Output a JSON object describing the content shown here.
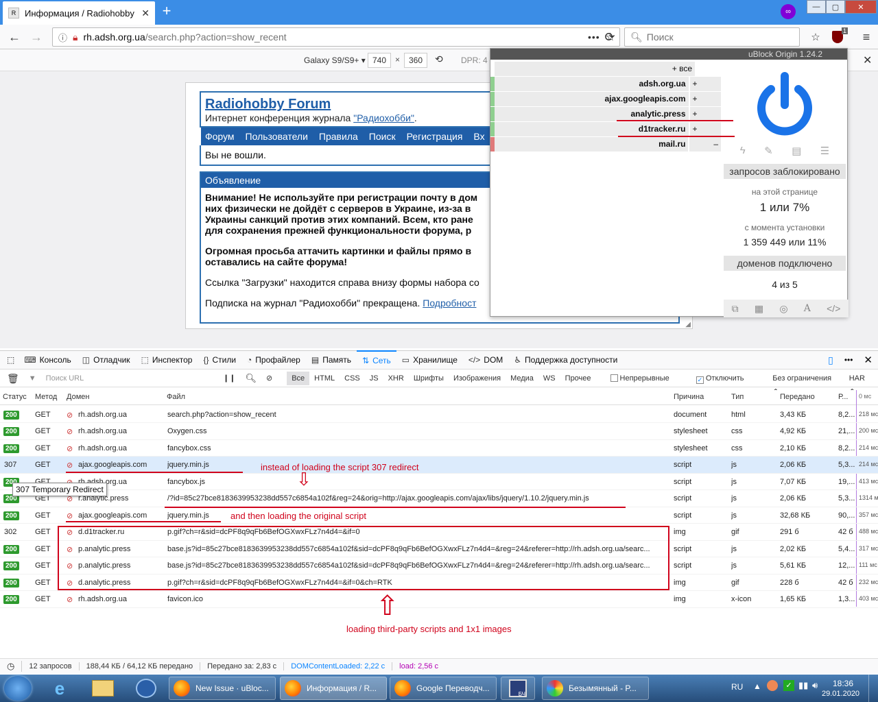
{
  "browser": {
    "tab_title": "Информация / Radiohobby Fo",
    "url_host": "rh.adsh.org.ua",
    "url_path": "/search.php?action=show_recent",
    "search_placeholder": "Поиск",
    "ext_badge": "1",
    "url_menu": "•••",
    "win_min": "—",
    "win_max": "▢",
    "win_close": "✕"
  },
  "responsive": {
    "device": "Galaxy S9/S9+ ▾",
    "width": "740",
    "height": "360",
    "dpr": "DPR: 4"
  },
  "forum": {
    "title": "Radiohobby Forum",
    "subtitle_pre": "Интернет конференция журнала ",
    "subtitle_link": "\"Радиохобби\"",
    "subtitle_post": ".",
    "menu": [
      "Форум",
      "Пользователи",
      "Правила",
      "Поиск",
      "Регистрация",
      "Вх"
    ],
    "not_logged": "Вы не вошли.",
    "announce_title": "Объявление",
    "p1": "Внимание! Не используйте при регистрации почту в дом них физически не дойдёт с серверов в Украине, из-за в Украины санкций против этих компаний. Всем, кто ране для сохранения прежней функциональности форума, р",
    "p2": "Огромная просьба аттачить картинки и файлы прямо в оставались на сайте форума!",
    "p3": "Ссылка \"Загрузки\" находится справа внизу формы набора со",
    "p4_pre": "Подписка на журнал \"Радиохобби\" прекращена. ",
    "p4_link": "Подробност"
  },
  "ublock": {
    "title": "uBlock Origin 1.24.2",
    "all": "+ все",
    "domains": [
      {
        "name": "adsh.org.ua",
        "mark": "+",
        "color": "#8fcf8f"
      },
      {
        "name": "ajax.googleapis.com",
        "mark": "+",
        "color": "#8fcf8f"
      },
      {
        "name": "analytic.press",
        "mark": "+",
        "color": "#8fcf8f"
      },
      {
        "name": "d1tracker.ru",
        "mark": "+",
        "color": "#8fcf8f"
      },
      {
        "name": "mail.ru",
        "mark": "–",
        "color": "#e07a7a"
      }
    ],
    "blocked_label": "запросов заблокировано",
    "on_page_label": "на этой странице",
    "on_page_value": "1 или 7%",
    "since_install_label": "с момента установки",
    "since_install_value": "1 359 449 или 11%",
    "domains_label": "доменов подключено",
    "domains_value": "4 из 5",
    "accent": "#1a73e8"
  },
  "devtools": {
    "tabs": [
      {
        "icon": "⌨",
        "label": "Консоль"
      },
      {
        "icon": "◫",
        "label": "Отладчик"
      },
      {
        "icon": "⬚",
        "label": "Инспектор"
      },
      {
        "icon": "{}",
        "label": "Стили"
      },
      {
        "icon": "◔",
        "label": "Профайлер"
      },
      {
        "icon": "▤",
        "label": "Память"
      },
      {
        "icon": "⇅",
        "label": "Сеть"
      },
      {
        "icon": "▭",
        "label": "Хранилище"
      },
      {
        "icon": "</>",
        "label": "DOM"
      },
      {
        "icon": "♿",
        "label": "Поддержка доступности"
      }
    ],
    "filter_placeholder": "Поиск URL",
    "filters": [
      "Все",
      "HTML",
      "CSS",
      "JS",
      "XHR",
      "Шрифты",
      "Изображения",
      "Медиа",
      "WS",
      "Прочее"
    ],
    "persist_logs": "Непрерывные логи",
    "disable_cache": "Отключить кэш",
    "throttle": "Без ограничения ⇕",
    "har": "HAR ⇕",
    "columns": {
      "status": "Статус",
      "method": "Метод",
      "domain": "Домен",
      "file": "Файл",
      "cause": "Причина",
      "type": "Тип",
      "transferred": "Передано",
      "size": "Р...",
      "timeline": "0 мс"
    },
    "rows": [
      {
        "status": "200",
        "method": "GET",
        "domain": "rh.adsh.org.ua",
        "file": "search.php?action=show_recent",
        "cause": "document",
        "type": "html",
        "transferred": "3,43 КБ",
        "size": "8,2...",
        "time": "218 мс"
      },
      {
        "status": "200",
        "method": "GET",
        "domain": "rh.adsh.org.ua",
        "file": "Oxygen.css",
        "cause": "stylesheet",
        "type": "css",
        "transferred": "4,92 КБ",
        "size": "21,...",
        "time": "200 мс"
      },
      {
        "status": "200",
        "method": "GET",
        "domain": "rh.adsh.org.ua",
        "file": "fancybox.css",
        "cause": "stylesheet",
        "type": "css",
        "transferred": "2,10 КБ",
        "size": "8,2...",
        "time": "214 мс"
      },
      {
        "status": "307",
        "method": "GET",
        "domain": "ajax.googleapis.com",
        "file": "jquery.min.js",
        "cause": "script",
        "type": "js",
        "transferred": "2,06 КБ",
        "size": "5,3...",
        "time": "214 мс"
      },
      {
        "status": "200",
        "method": "GET",
        "domain": "rh.adsh.org.ua",
        "file": "fancybox.js",
        "cause": "script",
        "type": "js",
        "transferred": "7,07 КБ",
        "size": "19,...",
        "time": "413 мс"
      },
      {
        "status": "200",
        "method": "GET",
        "domain": "r.analytic.press",
        "file": "/?id=85c27bce8183639953238dd557c6854a102f&reg=24&orig=http://ajax.googleapis.com/ajax/libs/jquery/1.10.2/jquery.min.js",
        "cause": "script",
        "type": "js",
        "transferred": "2,06 КБ",
        "size": "5,3...",
        "time": "1314 м"
      },
      {
        "status": "200",
        "method": "GET",
        "domain": "ajax.googleapis.com",
        "file": "jquery.min.js",
        "cause": "script",
        "type": "js",
        "transferred": "32,68 КБ",
        "size": "90,...",
        "time": "357 мс"
      },
      {
        "status": "302",
        "method": "GET",
        "domain": "d.d1tracker.ru",
        "file": "p.gif?ch=r&sid=dcPF8q9qFb6BefOGXwxFLz7n4d4=&if=0",
        "cause": "img",
        "type": "gif",
        "transferred": "291 б",
        "size": "42 б",
        "time": "488 мс"
      },
      {
        "status": "200",
        "method": "GET",
        "domain": "p.analytic.press",
        "file": "base.js?id=85c27bce8183639953238dd557c6854a102f&sid=dcPF8q9qFb6BefOGXwxFLz7n4d4=&reg=24&referer=http://rh.adsh.org.ua/searc...",
        "cause": "script",
        "type": "js",
        "transferred": "2,02 КБ",
        "size": "5,4...",
        "time": "317 мс"
      },
      {
        "status": "200",
        "method": "GET",
        "domain": "p.analytic.press",
        "file": "base.js?id=85c27bce8183639953238dd557c6854a102f&sid=dcPF8q9qFb6BefOGXwxFLz7n4d4=&reg=24&referer=http://rh.adsh.org.ua/searc...",
        "cause": "script",
        "type": "js",
        "transferred": "5,61 КБ",
        "size": "12,...",
        "time": "111 мс"
      },
      {
        "status": "200",
        "method": "GET",
        "domain": "d.analytic.press",
        "file": "p.gif?ch=r&sid=dcPF8q9qFb6BefOGXwxFLz7n4d4=&if=0&ch=RTK",
        "cause": "img",
        "type": "gif",
        "transferred": "228 б",
        "size": "42 б",
        "time": "232 мс"
      },
      {
        "status": "200",
        "method": "GET",
        "domain": "rh.adsh.org.ua",
        "file": "favicon.ico",
        "cause": "img",
        "type": "x-icon",
        "transferred": "1,65 КБ",
        "size": "1,3...",
        "time": "403 мс"
      }
    ],
    "tooltip": "307 Temporary Redirect",
    "status_bar": {
      "requests": "12 запросов",
      "size": "188,44 КБ / 64,12 КБ передано",
      "finish": "Передано за: 2,83 с",
      "dcl": "DOMContentLoaded: 2,22 с",
      "load": "load: 2,56 с"
    }
  },
  "annotations": {
    "redirect": "instead of loading the script 307 redirect",
    "original": "and then loading the original script",
    "thirdparty": "loading third-party scripts and 1x1 images",
    "color": "#d0021b"
  },
  "taskbar": {
    "items": [
      "New Issue · uBloc...",
      "Информация / R...",
      "Google Переводч...",
      "Безымянный - P..."
    ],
    "lang": "RU",
    "time": "18:36",
    "date": "29.01.2020",
    "save_badge": "БЧ"
  }
}
